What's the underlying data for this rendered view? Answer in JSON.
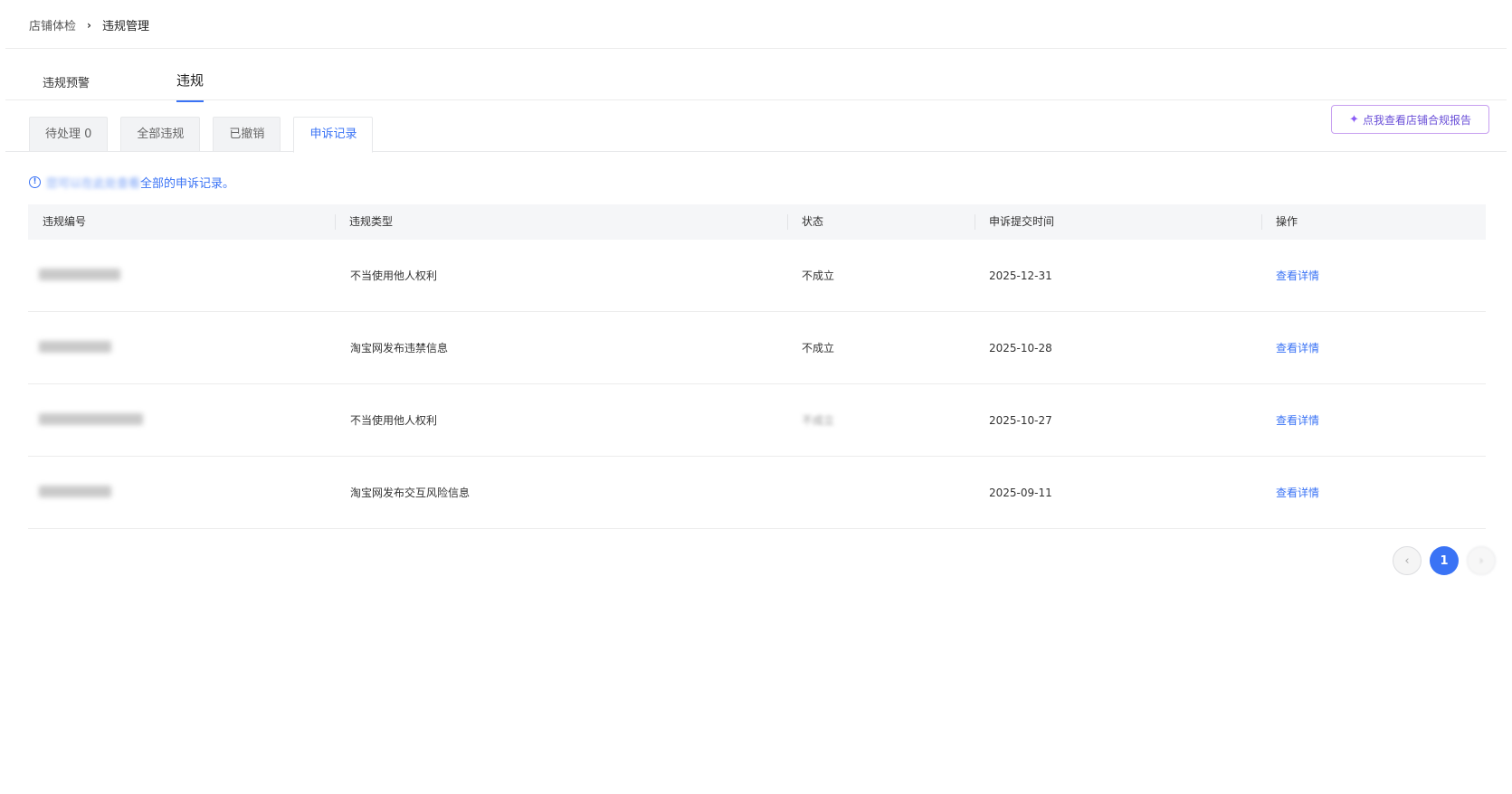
{
  "breadcrumb": {
    "parent": "店铺体检",
    "separator": "›",
    "current": "违规管理"
  },
  "main_tabs": [
    {
      "label": "违规预警"
    },
    {
      "label": "违规"
    }
  ],
  "sub_tabs": [
    {
      "label": "待处理 0"
    },
    {
      "label": "全部违规"
    },
    {
      "label": "已撤销"
    },
    {
      "label": "申诉记录"
    }
  ],
  "report_button": {
    "label": "点我查看店铺合规报告"
  },
  "notice": {
    "blurred": "您可以在此处查看",
    "text": "全部的申诉记录。"
  },
  "table": {
    "headers": [
      "违规编号",
      "违规类型",
      "状态",
      "申诉提交时间",
      "操作"
    ],
    "rows": [
      {
        "type": "不当使用他人权利",
        "status": "不成立",
        "date": "2025-12-31",
        "action": "查看详情"
      },
      {
        "type": "淘宝网发布违禁信息",
        "status": "不成立",
        "date": "2025-10-28",
        "action": "查看详情"
      },
      {
        "type": "不当使用他人权利",
        "status": "不成立",
        "date": "2025-10-27",
        "action": "查看详情"
      },
      {
        "type": "淘宝网发布交互风险信息",
        "status": "",
        "date": "2025-09-11",
        "action": "查看详情"
      }
    ]
  },
  "pagination": {
    "current_page": "1",
    "prev_symbol": "‹",
    "next_symbol": "›"
  },
  "colors": {
    "accent": "#3a73f5",
    "report_border": "#c79ff0"
  }
}
